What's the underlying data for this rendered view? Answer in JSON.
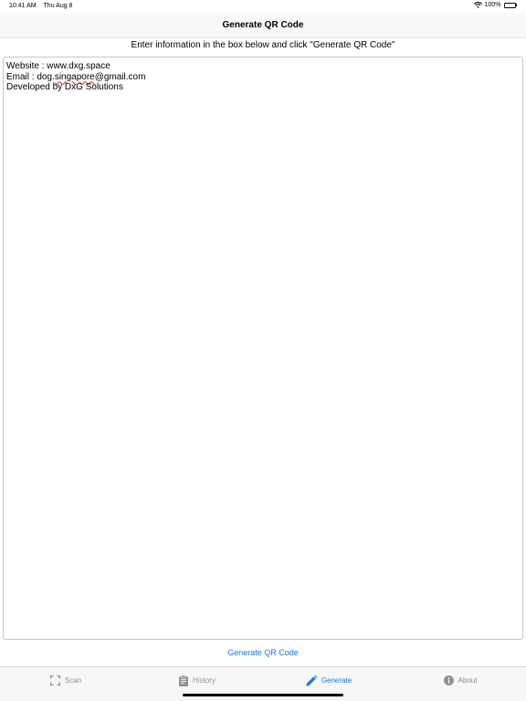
{
  "status_bar": {
    "time": "10:41 AM",
    "date": "Thu Aug 8",
    "battery": "100%"
  },
  "nav": {
    "title": "Generate QR Code"
  },
  "instruction": "Enter information in the box below and click \"Generate QR Code\"",
  "text_box": {
    "line1": "Website : www.dxg.space",
    "line2_prefix": "Email : dog.",
    "line2_misspelled": "singapore",
    "line2_suffix": "@gmail.com",
    "line3": "Developed by DxG Solutions"
  },
  "generate_button": "Generate QR Code",
  "tabs": [
    {
      "label": "Scan",
      "icon": "scan-frame-icon"
    },
    {
      "label": "History",
      "icon": "clipboard-icon"
    },
    {
      "label": "Generate",
      "icon": "pencil-icon"
    },
    {
      "label": "About",
      "icon": "info-icon"
    }
  ],
  "colors": {
    "accent": "#1a78e6",
    "inactive": "#8e8e93"
  }
}
